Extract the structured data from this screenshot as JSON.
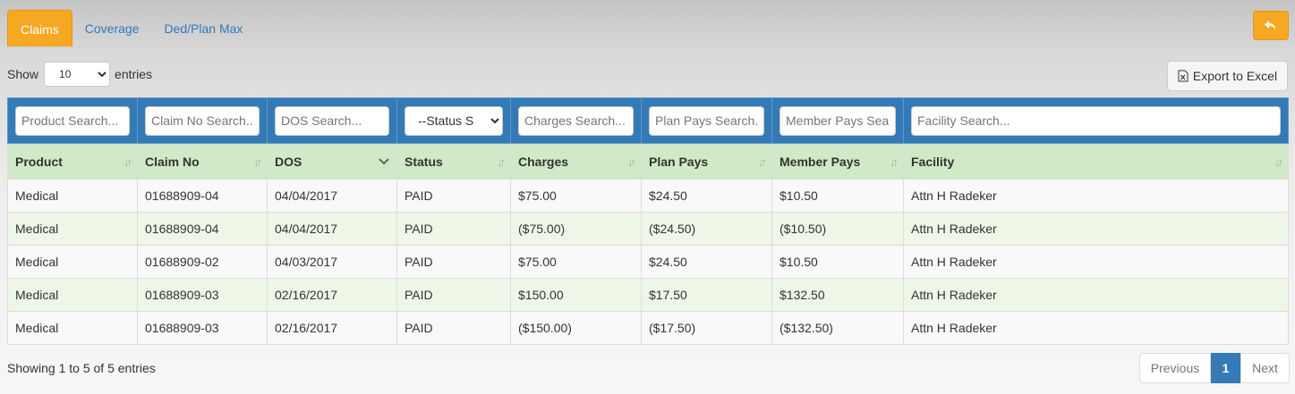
{
  "tabs": [
    {
      "label": "Claims",
      "active": true
    },
    {
      "label": "Coverage",
      "active": false
    },
    {
      "label": "Ded/Plan Max",
      "active": false
    }
  ],
  "colors": {
    "accent": "#f7a823",
    "primary": "#337ab7",
    "header_row": "#d0e9c6",
    "stripe": "#eef6e8"
  },
  "back_button": {
    "icon": "undo-arrow-icon"
  },
  "length_menu": {
    "show_label": "Show",
    "selected": "10",
    "entries_label": "entries"
  },
  "export": {
    "label": "Export to Excel",
    "icon": "excel-file-icon"
  },
  "filters": {
    "product": "Product Search...",
    "claim_no": "Claim No Search...",
    "dos": "DOS Search...",
    "status": "--Status S",
    "charges": "Charges Search...",
    "plan_pays": "Plan Pays Search...",
    "member_pays": "Member Pays Search...",
    "facility": "Facility Search..."
  },
  "columns": [
    "Product",
    "Claim No",
    "DOS",
    "Status",
    "Charges",
    "Plan Pays",
    "Member Pays",
    "Facility"
  ],
  "rows": [
    [
      "Medical",
      "01688909-04",
      "04/04/2017",
      "PAID",
      "$75.00",
      "$24.50",
      "$10.50",
      "Attn H Radeker"
    ],
    [
      "Medical",
      "01688909-04",
      "04/04/2017",
      "PAID",
      "($75.00)",
      "($24.50)",
      "($10.50)",
      "Attn H Radeker"
    ],
    [
      "Medical",
      "01688909-02",
      "04/03/2017",
      "PAID",
      "$75.00",
      "$24.50",
      "$10.50",
      "Attn H Radeker"
    ],
    [
      "Medical",
      "01688909-03",
      "02/16/2017",
      "PAID",
      "$150.00",
      "$17.50",
      "$132.50",
      "Attn H Radeker"
    ],
    [
      "Medical",
      "01688909-03",
      "02/16/2017",
      "PAID",
      "($150.00)",
      "($17.50)",
      "($132.50)",
      "Attn H Radeker"
    ]
  ],
  "info": "Showing 1 to 5 of 5 entries",
  "pagination": {
    "previous": "Previous",
    "page": "1",
    "next": "Next"
  }
}
